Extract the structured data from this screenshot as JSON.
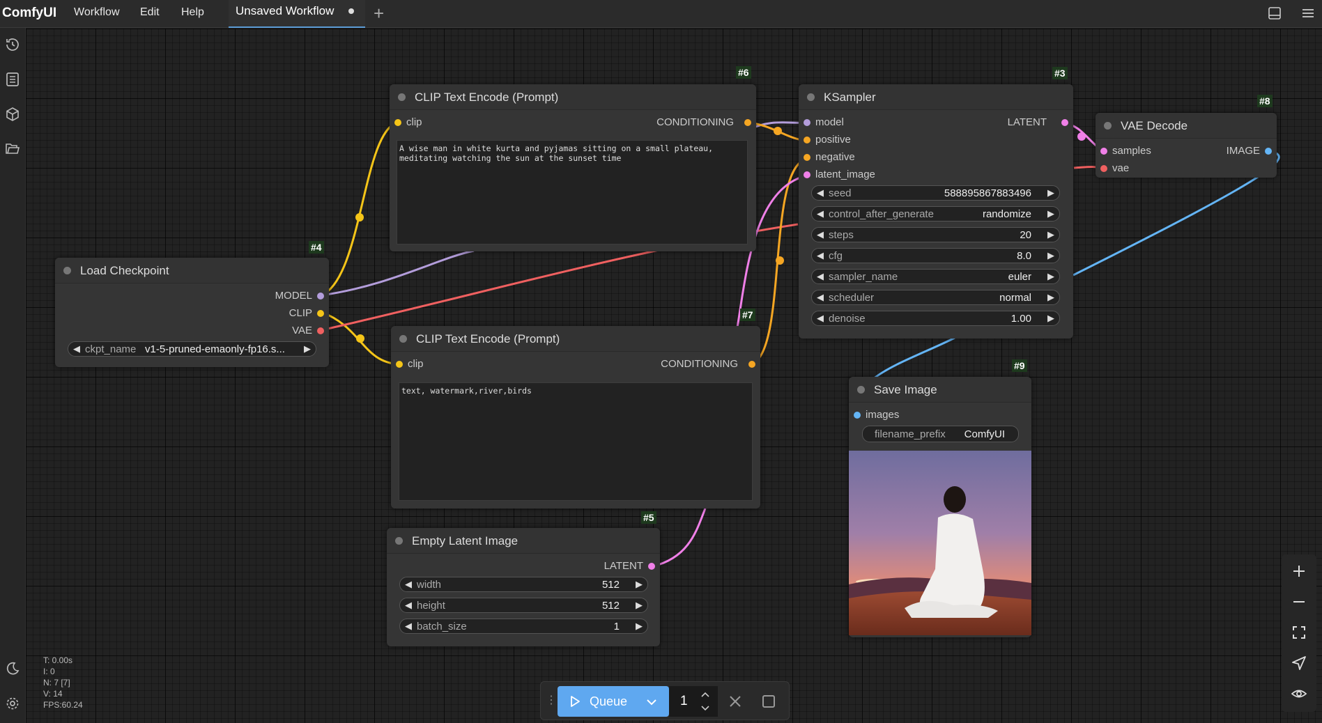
{
  "app": {
    "name": "ComfyUI"
  },
  "menu": [
    "Workflow",
    "Edit",
    "Help"
  ],
  "tab": {
    "title": "Unsaved Workflow"
  },
  "colors": {
    "clip": "#f5c518",
    "model": "#b39ddb",
    "vae": "#f06060",
    "conditioning": "#f5a623",
    "latent": "#f080e8",
    "image": "#64b5f6",
    "accent": "#5fa8f0"
  },
  "nodes": {
    "n6": {
      "id": "#6",
      "title": "CLIP Text Encode (Prompt)",
      "input": "clip",
      "output": "CONDITIONING",
      "text": "A wise man in white kurta and pyjamas sitting on a small plateau,\nmeditating watching the sun at the sunset time"
    },
    "n7": {
      "id": "#7",
      "title": "CLIP Text Encode (Prompt)",
      "input": "clip",
      "output": "CONDITIONING",
      "text": "text, watermark,river,birds"
    },
    "n4": {
      "id": "#4",
      "title": "Load Checkpoint",
      "outputs": [
        "MODEL",
        "CLIP",
        "VAE"
      ],
      "widget": {
        "name": "ckpt_name",
        "value": "v1-5-pruned-emaonly-fp16.s..."
      }
    },
    "n3": {
      "id": "#3",
      "title": "KSampler",
      "inputs": [
        "model",
        "positive",
        "negative",
        "latent_image"
      ],
      "output": "LATENT",
      "widgets": [
        {
          "name": "seed",
          "value": "588895867883496"
        },
        {
          "name": "control_after_generate",
          "value": "randomize"
        },
        {
          "name": "steps",
          "value": "20"
        },
        {
          "name": "cfg",
          "value": "8.0"
        },
        {
          "name": "sampler_name",
          "value": "euler"
        },
        {
          "name": "scheduler",
          "value": "normal"
        },
        {
          "name": "denoise",
          "value": "1.00"
        }
      ]
    },
    "n8": {
      "id": "#8",
      "title": "VAE Decode",
      "inputs": [
        "samples",
        "vae"
      ],
      "output": "IMAGE"
    },
    "n9": {
      "id": "#9",
      "title": "Save Image",
      "input": "images",
      "widget": {
        "name": "filename_prefix",
        "value": "ComfyUI"
      }
    },
    "n5": {
      "id": "#5",
      "title": "Empty Latent Image",
      "output": "LATENT",
      "widgets": [
        {
          "name": "width",
          "value": "512"
        },
        {
          "name": "height",
          "value": "512"
        },
        {
          "name": "batch_size",
          "value": "1"
        }
      ]
    }
  },
  "stats": {
    "t": "T: 0.00s",
    "i": "I: 0",
    "n": "N: 7 [7]",
    "v": "V: 14",
    "fps": "FPS:60.24"
  },
  "queue": {
    "label": "Queue",
    "count": "1"
  }
}
